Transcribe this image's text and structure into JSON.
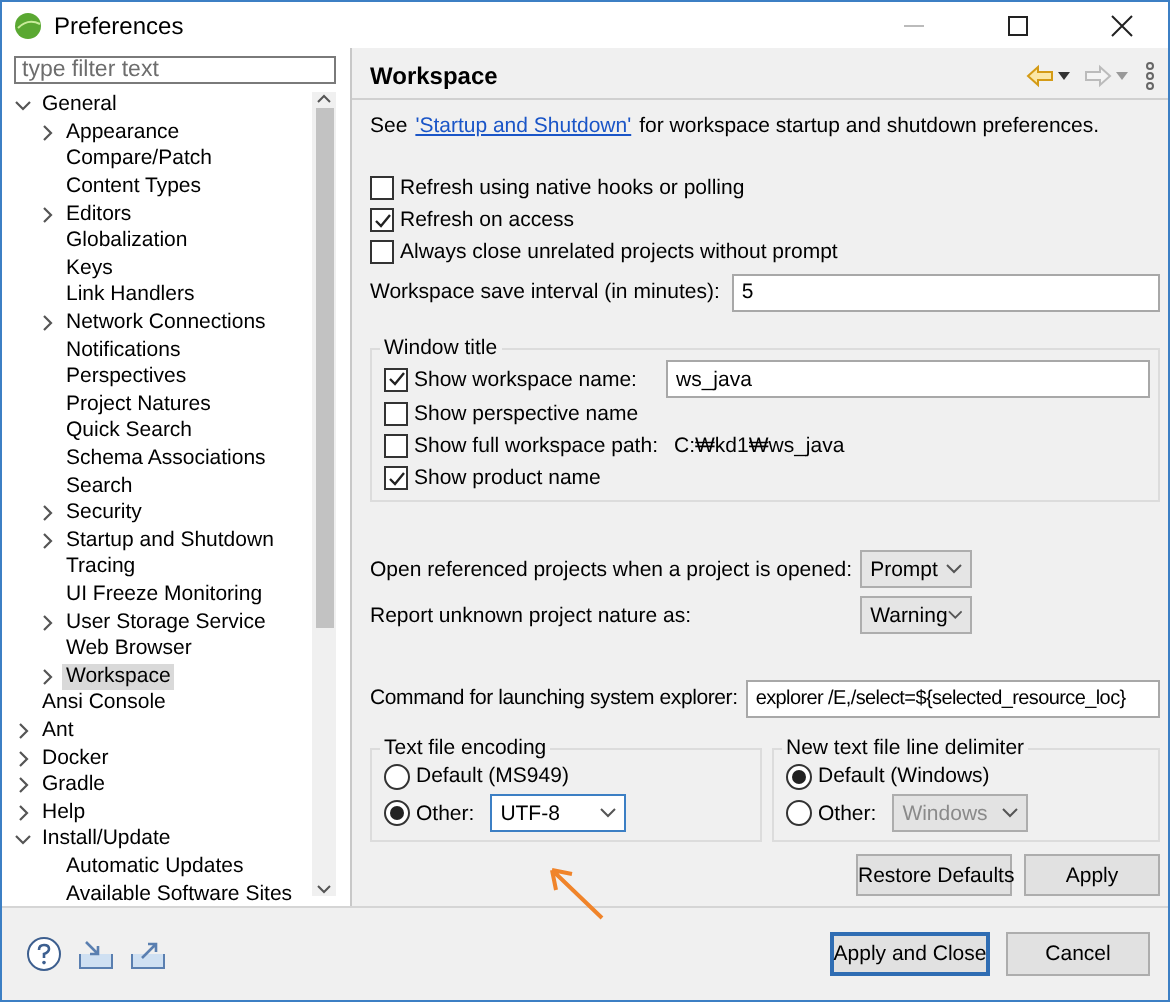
{
  "window": {
    "title": "Preferences"
  },
  "filter": {
    "placeholder": "type filter text"
  },
  "tree": [
    {
      "label": "General",
      "expanded": true,
      "selected": false,
      "children": [
        {
          "label": "Appearance",
          "expanded": false,
          "selected": false
        },
        {
          "label": "Compare/Patch",
          "selected": false
        },
        {
          "label": "Content Types",
          "selected": false
        },
        {
          "label": "Editors",
          "expanded": false,
          "selected": false
        },
        {
          "label": "Globalization",
          "selected": false
        },
        {
          "label": "Keys",
          "selected": false
        },
        {
          "label": "Link Handlers",
          "selected": false
        },
        {
          "label": "Network Connections",
          "expanded": false,
          "selected": false
        },
        {
          "label": "Notifications",
          "selected": false
        },
        {
          "label": "Perspectives",
          "selected": false
        },
        {
          "label": "Project Natures",
          "selected": false
        },
        {
          "label": "Quick Search",
          "selected": false
        },
        {
          "label": "Schema Associations",
          "selected": false
        },
        {
          "label": "Search",
          "selected": false
        },
        {
          "label": "Security",
          "expanded": false,
          "selected": false
        },
        {
          "label": "Startup and Shutdown",
          "expanded": false,
          "selected": false
        },
        {
          "label": "Tracing",
          "selected": false
        },
        {
          "label": "UI Freeze Monitoring",
          "selected": false
        },
        {
          "label": "User Storage Service",
          "expanded": false,
          "selected": false
        },
        {
          "label": "Web Browser",
          "selected": false
        },
        {
          "label": "Workspace",
          "expanded": false,
          "selected": true
        }
      ]
    },
    {
      "label": "Ansi Console",
      "selected": false
    },
    {
      "label": "Ant",
      "expanded": false,
      "selected": false
    },
    {
      "label": "Docker",
      "expanded": false,
      "selected": false
    },
    {
      "label": "Gradle",
      "expanded": false,
      "selected": false
    },
    {
      "label": "Help",
      "expanded": false,
      "selected": false
    },
    {
      "label": "Install/Update",
      "expanded": true,
      "selected": false,
      "children": [
        {
          "label": "Automatic Updates",
          "selected": false
        },
        {
          "label": "Available Software Sites",
          "selected": false
        }
      ]
    }
  ],
  "page": {
    "title": "Workspace",
    "intro": {
      "before": "See",
      "link": "'Startup and Shutdown'",
      "after": "for workspace startup and shutdown preferences."
    },
    "options": [
      {
        "label": "Refresh using native hooks or polling",
        "checked": false
      },
      {
        "label": "Refresh on access",
        "checked": true
      },
      {
        "label": "Always close unrelated projects without prompt",
        "checked": false
      }
    ],
    "save_interval": {
      "label": "Workspace save interval (in minutes):",
      "value": "5"
    },
    "window_title": {
      "title": "Window title",
      "items": [
        {
          "kind": "field",
          "label": "Show workspace name:",
          "checked": true,
          "value": "ws_java"
        },
        {
          "kind": "plain",
          "label": "Show perspective name",
          "checked": false
        },
        {
          "kind": "text",
          "label": "Show full workspace path:",
          "checked": false,
          "value": "C:₩kd1₩ws_java"
        },
        {
          "kind": "plain",
          "label": "Show product name",
          "checked": true
        }
      ]
    },
    "combos": [
      {
        "label": "Open referenced projects when a project is opened:",
        "value": "Prompt"
      },
      {
        "label": "Report unknown project nature as:",
        "value": "Warning"
      }
    ],
    "explorer": {
      "label": "Command for launching system explorer:",
      "value": "explorer /E,/select=${selected_resource_loc}"
    },
    "groups": [
      {
        "title": "Text file encoding",
        "options": [
          {
            "label": "Default (MS949)",
            "selected": false
          },
          {
            "label": "Other:",
            "selected": true,
            "value": "UTF-8",
            "disabled": false
          }
        ]
      },
      {
        "title": "New text file line delimiter",
        "options": [
          {
            "label": "Default (Windows)",
            "selected": true
          },
          {
            "label": "Other:",
            "selected": false,
            "value": "Windows",
            "disabled": true
          }
        ]
      }
    ],
    "page_buttons": [
      "Restore Defaults",
      "Apply"
    ]
  },
  "footer_buttons": [
    {
      "label": "Apply and Close",
      "default": true
    },
    {
      "label": "Cancel",
      "default": false
    }
  ]
}
